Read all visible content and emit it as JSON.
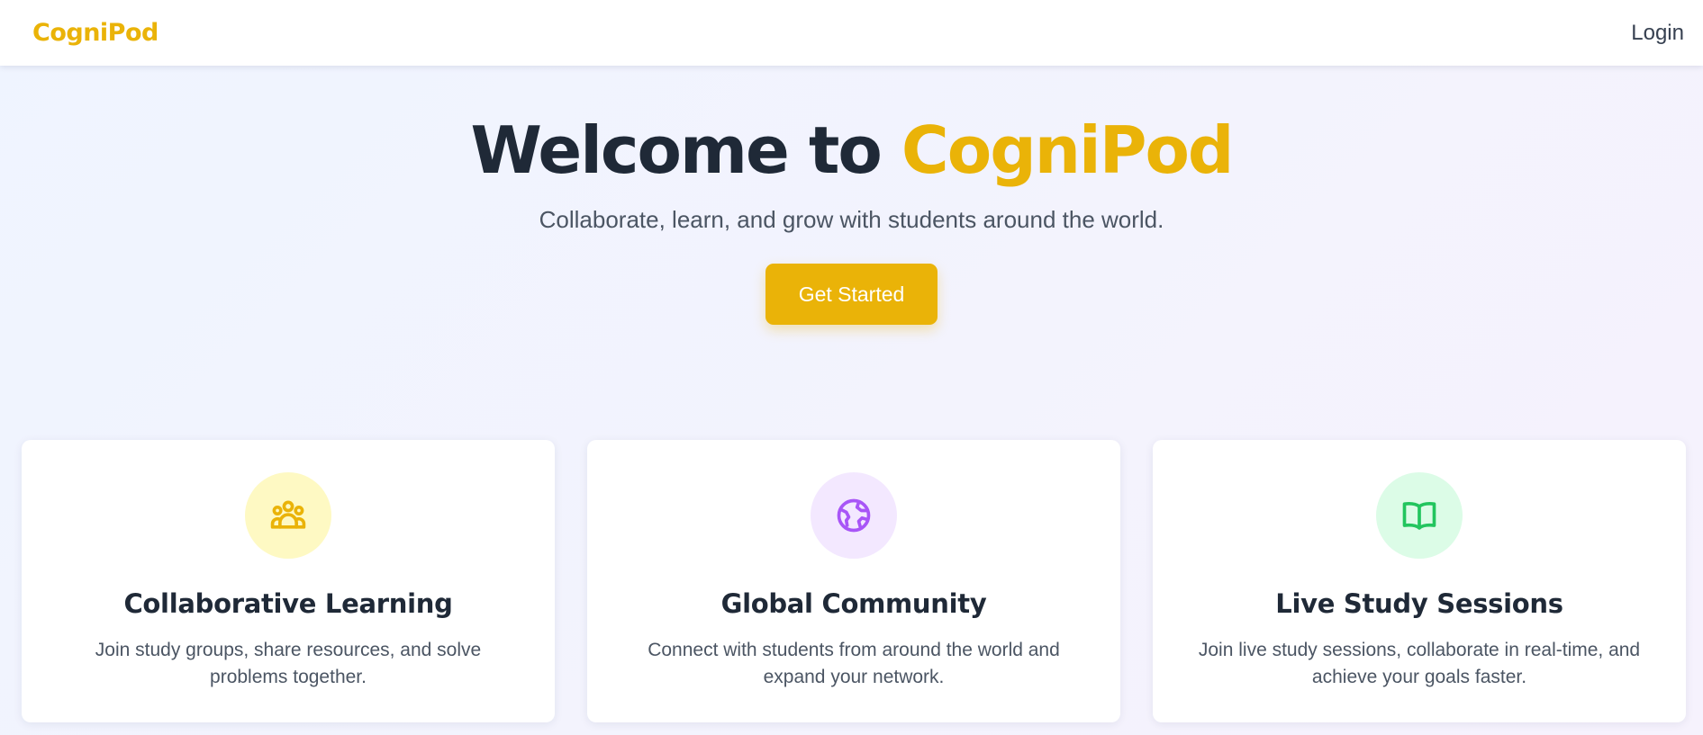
{
  "nav": {
    "brand": "CogniPod",
    "login_label": "Login"
  },
  "hero": {
    "title_prefix": "Welcome to ",
    "title_accent": "CogniPod",
    "subtitle": "Collaborate, learn, and grow with students around the world.",
    "cta_label": "Get Started"
  },
  "features": [
    {
      "title": "Collaborative Learning",
      "description": "Join study groups, share resources, and solve problems together.",
      "icon": "users-icon",
      "icon_color": "#eab308",
      "icon_bg": "#fef9c3"
    },
    {
      "title": "Global Community",
      "description": "Connect with students from around the world and expand your network.",
      "icon": "globe-icon",
      "icon_color": "#a855f7",
      "icon_bg": "#f3e8ff"
    },
    {
      "title": "Live Study Sessions",
      "description": "Join live study sessions, collaborate in real-time, and achieve your goals faster.",
      "icon": "book-open-icon",
      "icon_color": "#22c55e",
      "icon_bg": "#dcfce7"
    }
  ],
  "colors": {
    "accent": "#eab308",
    "text_dark": "#1f2937",
    "text_muted": "#4b5563"
  }
}
